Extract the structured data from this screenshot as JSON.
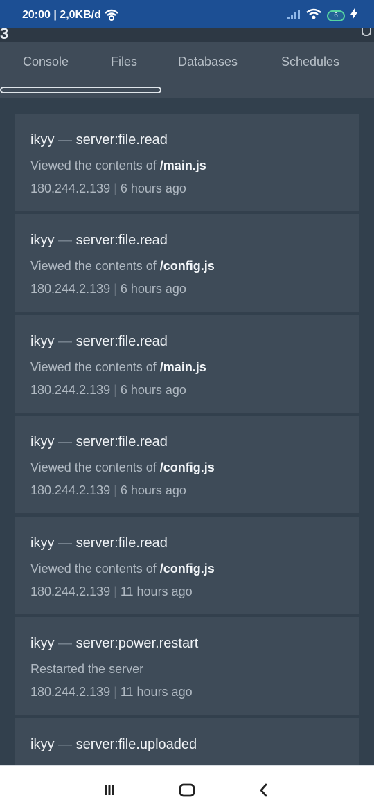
{
  "status": {
    "time": "20:00 | 2,0KB/d",
    "battery": "6"
  },
  "strip": {
    "left_glyph": "3"
  },
  "tabs": [
    {
      "label": "Console"
    },
    {
      "label": "Files"
    },
    {
      "label": "Databases"
    },
    {
      "label": "Schedules"
    }
  ],
  "activity": [
    {
      "user": "ikyy",
      "event": "server:file.read",
      "desc_prefix": "Viewed the contents of ",
      "desc_bold": "/main.js",
      "ip": "180.244.2.139",
      "time": "6 hours ago"
    },
    {
      "user": "ikyy",
      "event": "server:file.read",
      "desc_prefix": "Viewed the contents of ",
      "desc_bold": "/config.js",
      "ip": "180.244.2.139",
      "time": "6 hours ago"
    },
    {
      "user": "ikyy",
      "event": "server:file.read",
      "desc_prefix": "Viewed the contents of ",
      "desc_bold": "/main.js",
      "ip": "180.244.2.139",
      "time": "6 hours ago"
    },
    {
      "user": "ikyy",
      "event": "server:file.read",
      "desc_prefix": "Viewed the contents of ",
      "desc_bold": "/config.js",
      "ip": "180.244.2.139",
      "time": "6 hours ago"
    },
    {
      "user": "ikyy",
      "event": "server:file.read",
      "desc_prefix": "Viewed the contents of ",
      "desc_bold": "/config.js",
      "ip": "180.244.2.139",
      "time": "11 hours ago"
    },
    {
      "user": "ikyy",
      "event": "server:power.restart",
      "desc_prefix": "Restarted the server",
      "desc_bold": "",
      "ip": "180.244.2.139",
      "time": "11 hours ago"
    },
    {
      "user": "ikyy",
      "event": "server:file.uploaded",
      "desc_prefix": "",
      "desc_bold": "",
      "ip": "",
      "time": ""
    }
  ],
  "separators": {
    "dash": "—",
    "pipe": "|"
  },
  "icons": {
    "status": [
      "status-wifi-icon",
      "signal-bars-icon",
      "wifi-icon",
      "battery-icon",
      "charging-bolt-icon"
    ],
    "nav": [
      "menu-icon",
      "home-icon",
      "back-icon"
    ]
  },
  "colors": {
    "status_bar": "#1c4f94",
    "tab_bar": "#3f4b58",
    "card": "#3e4b58",
    "background": "#32404d",
    "battery_accent": "#56d4a2"
  }
}
